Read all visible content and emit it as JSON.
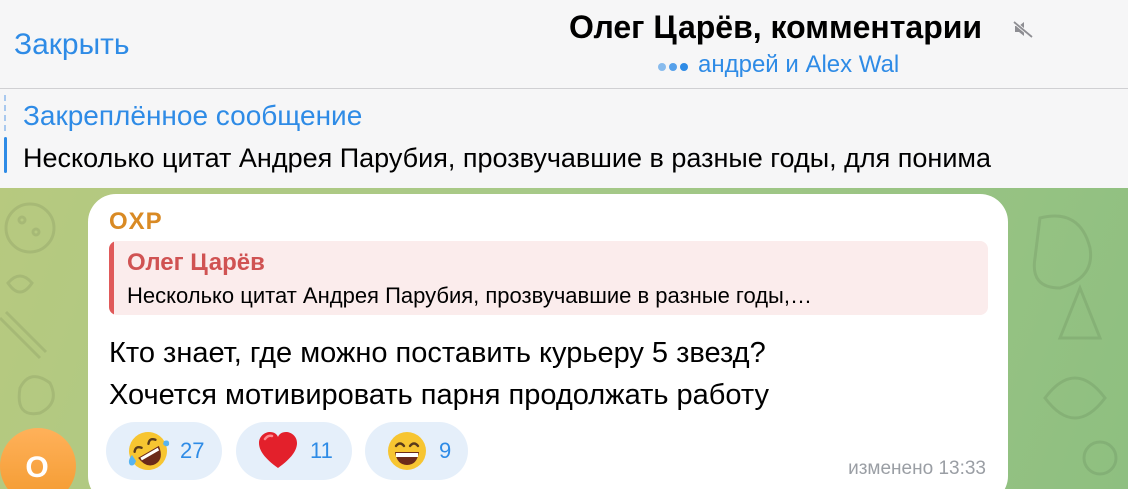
{
  "header": {
    "close_label": "Закрыть",
    "title": "Олег Царёв, комментарии",
    "typing_text": "андрей и Alex Wal",
    "icons": {
      "mute": "muted-speaker-icon",
      "typing": "typing-dots-icon"
    }
  },
  "pinned": {
    "title": "Закреплённое сообщение",
    "text": "Несколько цитат Андрея Парубия, прозвучавшие в разные годы, для понима"
  },
  "message": {
    "sender": "OXP",
    "avatar_letter": "O",
    "reply": {
      "author": "Олег Царёв",
      "text": "Несколько цитат Андрея Парубия, прозвучавшие в разные годы,…"
    },
    "text_lines": [
      "Кто знает,  где можно поставить курьеру 5 звезд?",
      "Хочется мотивировать парня продолжать работу"
    ],
    "reactions": [
      {
        "emoji": "rolling-on-floor-laughing-icon",
        "count": "27"
      },
      {
        "emoji": "red-heart-icon",
        "count": "11"
      },
      {
        "emoji": "grinning-face-icon",
        "count": "9"
      }
    ],
    "edited_label": "изменено 13:33"
  },
  "colors": {
    "accent": "#2e8be6",
    "sender": "#d98a24",
    "reply_author": "#d05353",
    "reaction_bg": "#e5effa"
  }
}
